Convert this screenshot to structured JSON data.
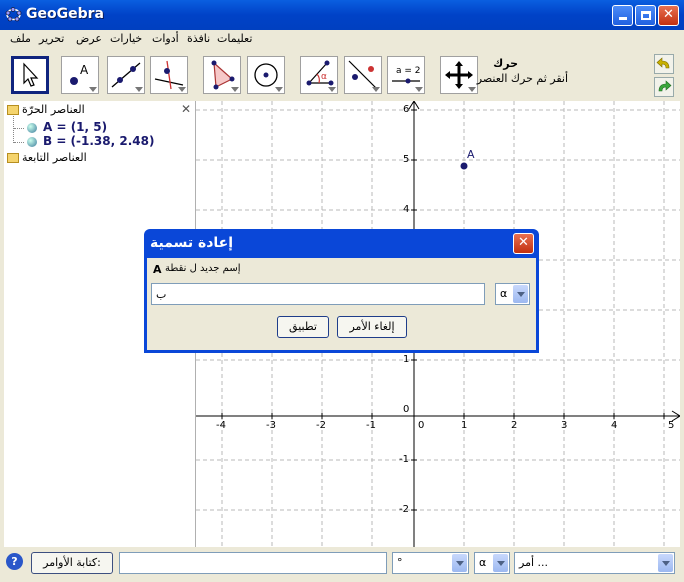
{
  "window": {
    "title": "GeoGebra"
  },
  "menu": {
    "items": [
      "ملف",
      "تحرير",
      "عرض",
      "خيارات",
      "أدوات",
      "نافذة",
      "تعليمات"
    ]
  },
  "toolbar": {
    "tool_name": "حرك",
    "tool_help": "أنقر ثم حرك العنصر",
    "slider_icon_label": "a = 2",
    "angle_icon_label": "α"
  },
  "algebra": {
    "free_header": "العناصر الحرّة",
    "dependent_header": "العناصر التابعة",
    "objects": [
      "A = (1, 5)",
      "B = (-1.38, 2.48)"
    ]
  },
  "graphics": {
    "point_label": "A",
    "x_ticks": [
      "-4",
      "-3",
      "-2",
      "-1",
      "0",
      "1",
      "2",
      "3",
      "4",
      "5"
    ],
    "y_ticks": [
      "6",
      "5",
      "4",
      "1",
      "0",
      "-1",
      "-2"
    ]
  },
  "dialog": {
    "title": "إعادة تسمية",
    "prompt": "إسم جديد ل نقطة",
    "prompt_object": "A",
    "input_value": "ب",
    "symbol_select": "α",
    "cancel_label": "إلغاء الأمر",
    "apply_label": "تطبيق"
  },
  "statusbar": {
    "input_label": "كتابة الأوامر:",
    "symbol1": "°",
    "symbol2": "α",
    "command_placeholder": "أمر ..."
  }
}
